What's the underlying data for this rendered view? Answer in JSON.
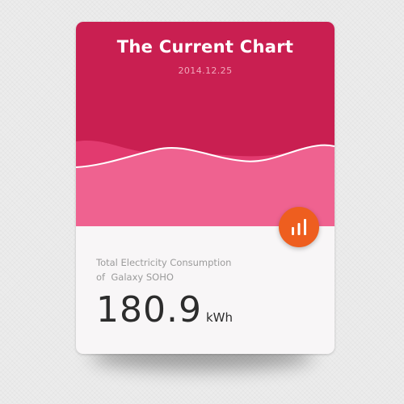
{
  "card": {
    "title": "The Current Chart",
    "date": "2014.12.25",
    "description_line1": "Total Electricity Consumption",
    "description_line2": "of  Galaxy SOHO",
    "value": "180.9",
    "unit": "kWh",
    "action_icon": "bar-chart-icon"
  },
  "colors": {
    "header_crimson": "#c91f51",
    "wave_pink": "#ef6290",
    "wave_back": "#e23a6f",
    "accent_orange": "#ee5e1f",
    "card_body": "#f8f6f7"
  }
}
